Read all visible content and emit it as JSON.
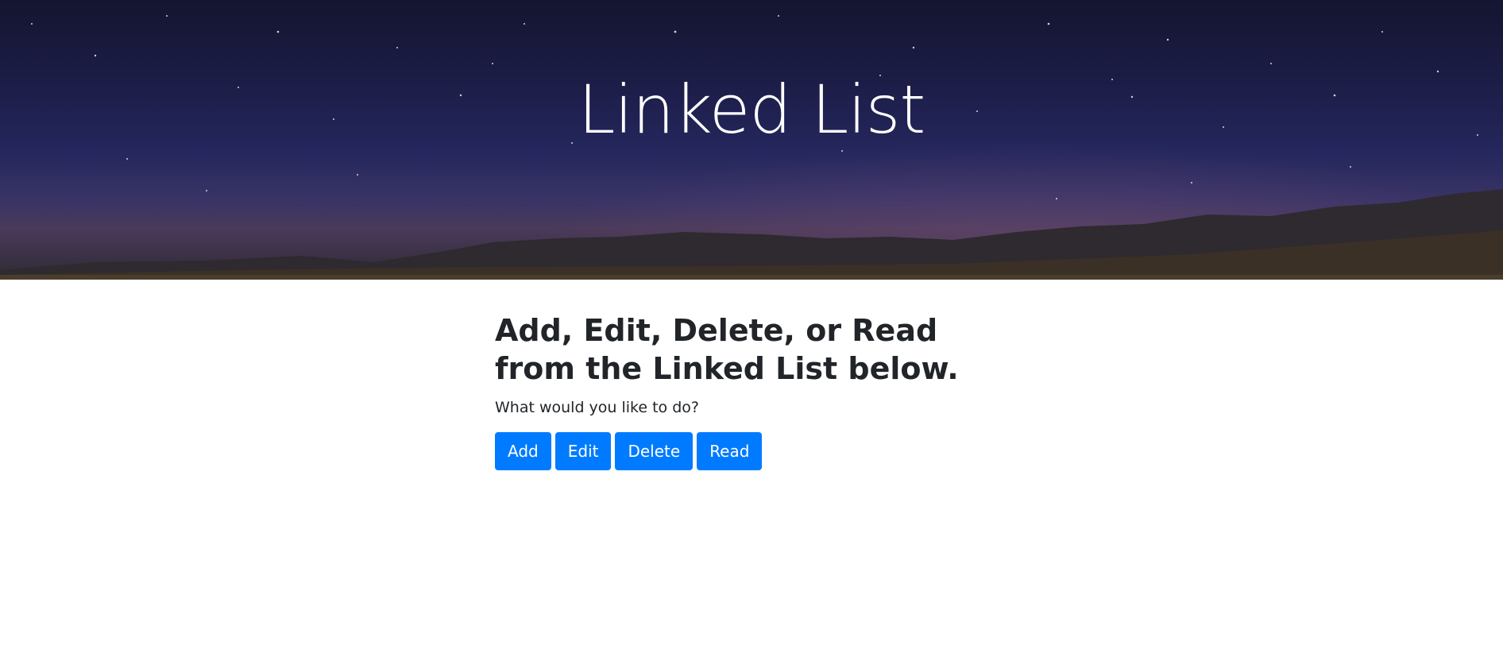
{
  "hero": {
    "title": "Linked List"
  },
  "main": {
    "heading": "Add, Edit, Delete, or Read from the Linked List below.",
    "prompt": "What would you like to do?",
    "buttons": [
      {
        "label": "Add"
      },
      {
        "label": "Edit"
      },
      {
        "label": "Delete"
      },
      {
        "label": "Read"
      }
    ]
  },
  "colors": {
    "primary_button": "#007bff",
    "text": "#212529",
    "hero_sky": "#1c1d47"
  }
}
